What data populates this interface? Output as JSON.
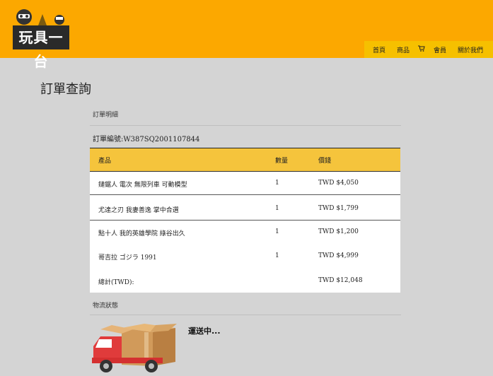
{
  "header": {
    "logo_text": "玩具一台",
    "nav": [
      "首頁",
      "商品",
      "會員",
      "關於我們"
    ],
    "cart_icon": "cart-icon"
  },
  "page": {
    "title": "訂單查詢",
    "details_label": "訂單明細",
    "order_number": "訂單編號:W387SQ2001107844"
  },
  "table": {
    "headers": [
      "產品",
      "數量",
      "價錢"
    ],
    "rows": [
      {
        "name": "鏈鋸人 電次 無限列車 可動模型",
        "qty": "1",
        "price": "TWD $4,050"
      },
      {
        "name": "尤達之刃 我妻善逸 掌中合選",
        "qty": "1",
        "price": "TWD $1,799"
      },
      {
        "name": "點十人 我的英雄學院 綠谷出久",
        "qty": "1",
        "price": "TWD $1,200"
      },
      {
        "name": "哥吉拉 ゴジラ 1991",
        "qty": "1",
        "price": "TWD $4,999"
      }
    ],
    "total_label": "總計(TWD):",
    "total_value": "TWD $12,048"
  },
  "shipping": {
    "label": "物流狀態",
    "status": "運送中...",
    "icon": "delivery-truck-icon"
  }
}
